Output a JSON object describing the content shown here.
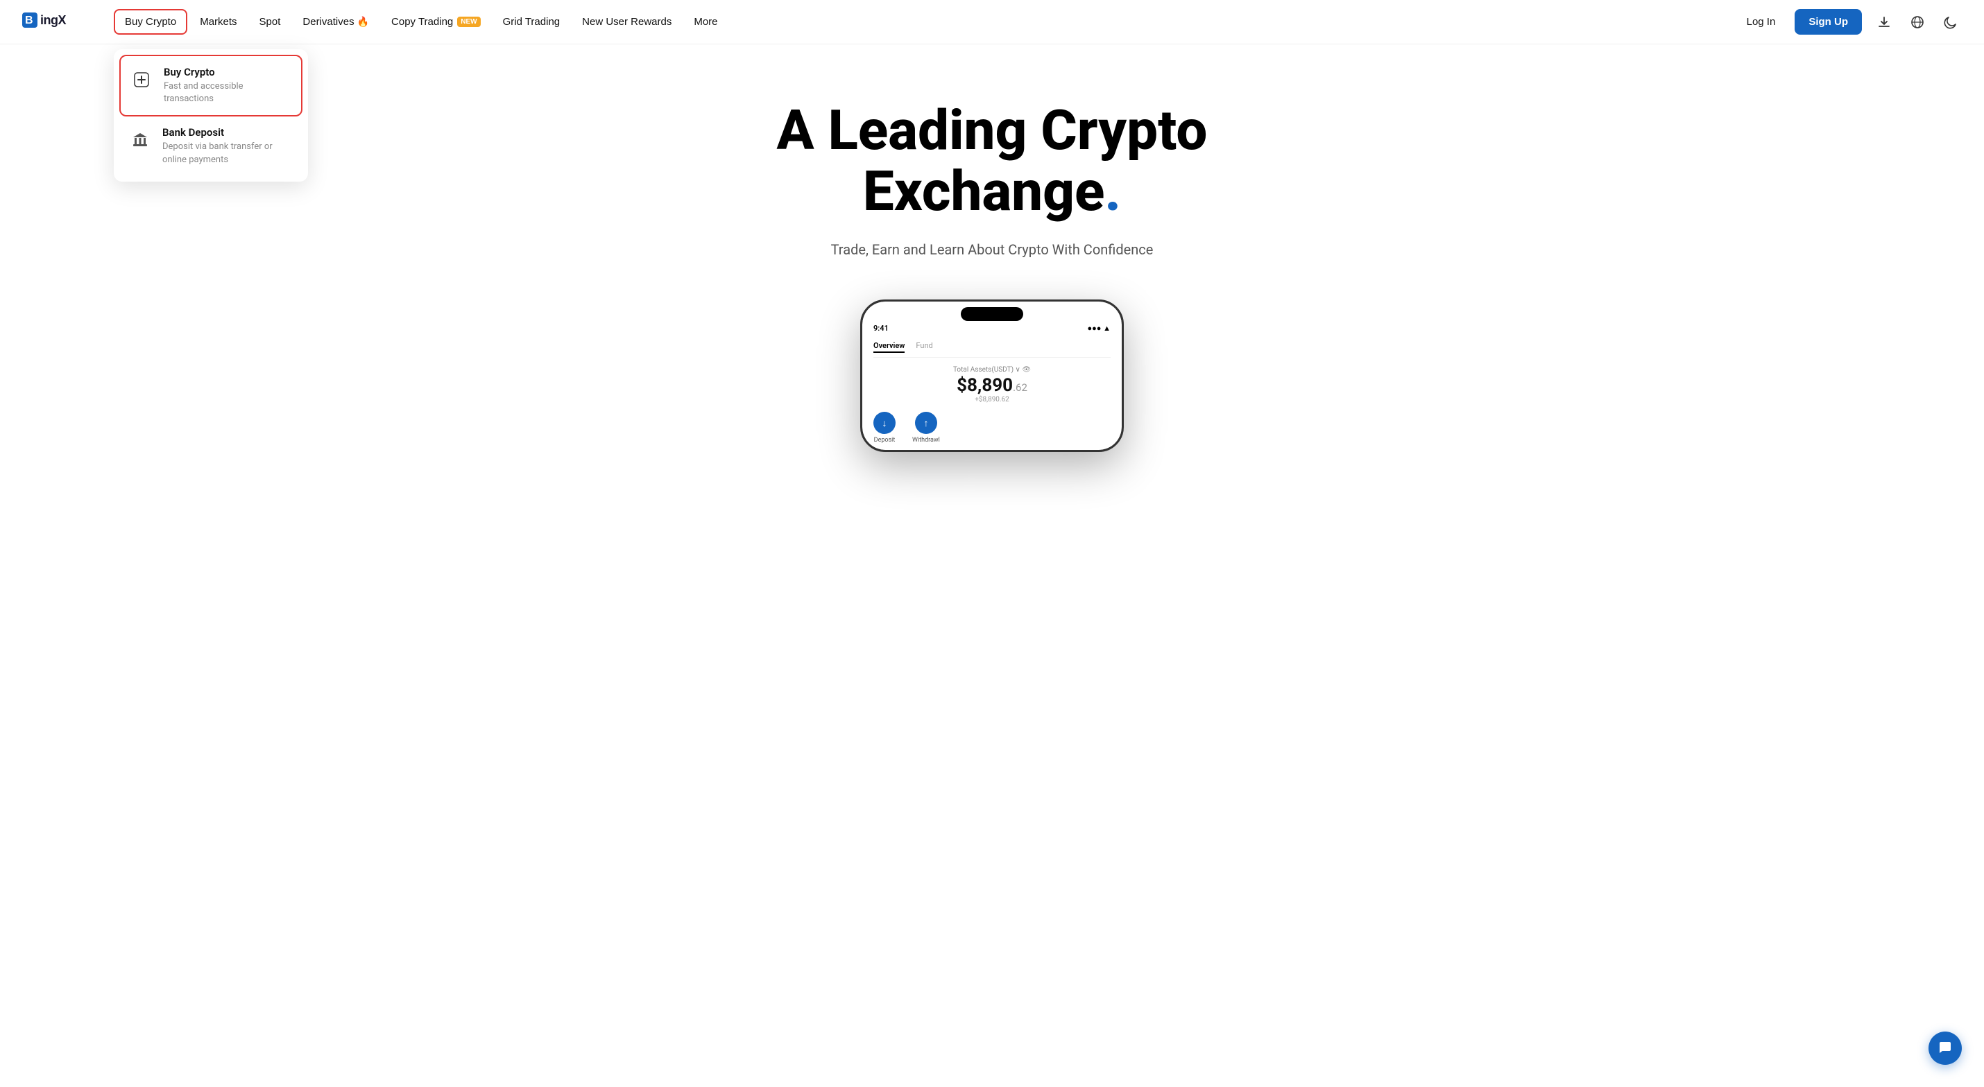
{
  "logo": {
    "text_bing": "Bing",
    "text_x": "X"
  },
  "navbar": {
    "items": [
      {
        "id": "buy-crypto",
        "label": "Buy Crypto",
        "active": true,
        "badge": null,
        "icon": null
      },
      {
        "id": "markets",
        "label": "Markets",
        "active": false,
        "badge": null,
        "icon": null
      },
      {
        "id": "spot",
        "label": "Spot",
        "active": false,
        "badge": null,
        "icon": null
      },
      {
        "id": "derivatives",
        "label": "Derivatives",
        "active": false,
        "badge": null,
        "icon": "fire"
      },
      {
        "id": "copy-trading",
        "label": "Copy Trading",
        "active": false,
        "badge": "NEW",
        "icon": null
      },
      {
        "id": "grid-trading",
        "label": "Grid Trading",
        "active": false,
        "badge": null,
        "icon": null
      },
      {
        "id": "new-user-rewards",
        "label": "New User Rewards",
        "active": false,
        "badge": null,
        "icon": null
      },
      {
        "id": "more",
        "label": "More",
        "active": false,
        "badge": null,
        "icon": null
      }
    ],
    "login_label": "Log In",
    "signup_label": "Sign Up"
  },
  "dropdown": {
    "items": [
      {
        "id": "buy-crypto-item",
        "title": "Buy Crypto",
        "subtitle": "Fast and accessible transactions",
        "icon": "plus",
        "highlighted": true
      },
      {
        "id": "bank-deposit-item",
        "title": "Bank Deposit",
        "subtitle": "Deposit via bank transfer or online payments",
        "icon": "bank",
        "highlighted": false
      }
    ]
  },
  "hero": {
    "title_line1": "A Leading Crypto",
    "title_line2": "Exchange",
    "title_dot": ".",
    "subtitle": "Trade, Earn and Learn About Crypto With Confidence"
  },
  "phone": {
    "time": "9:41",
    "tab_overview": "Overview",
    "tab_fund": "Fund",
    "assets_label": "Total Assets(USDT)",
    "amount_main": "$8,890",
    "amount_decimal": ".62",
    "change": "+$8,890.62",
    "action_deposit": "Deposit",
    "action_withdraw": "Withdrawl"
  },
  "chat": {
    "icon": "💬"
  }
}
